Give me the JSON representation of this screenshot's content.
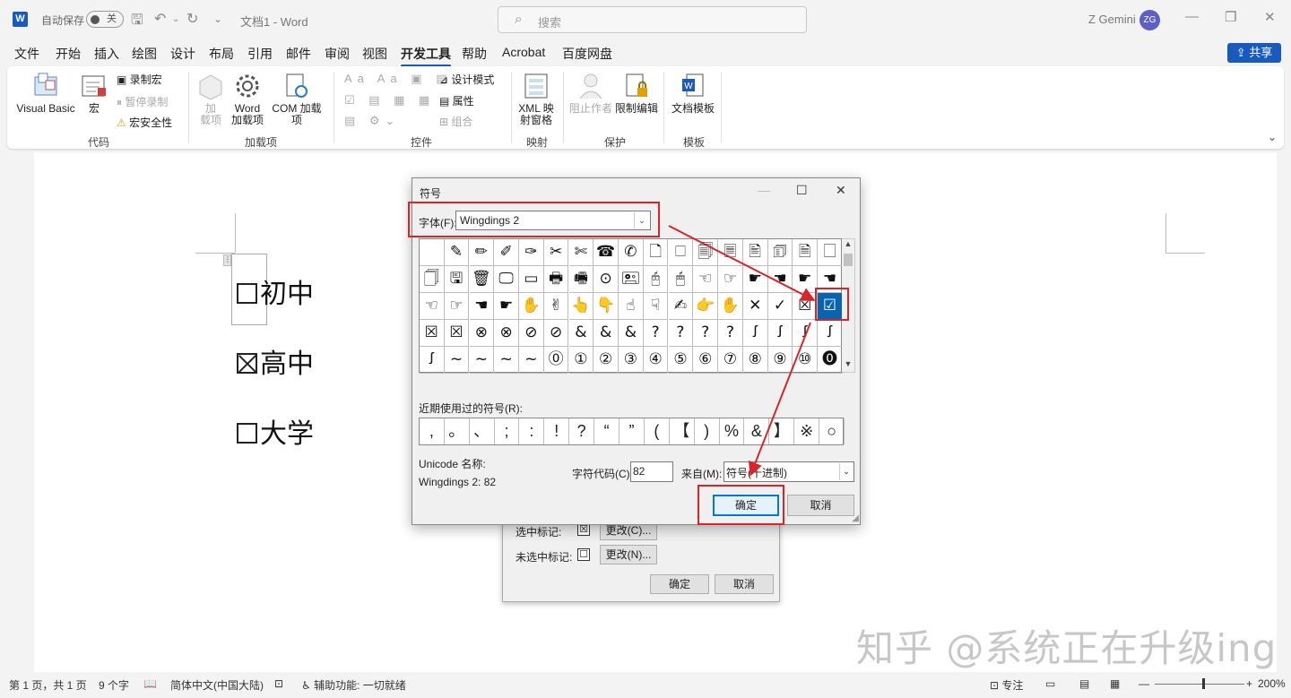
{
  "titlebar": {
    "app_icon": "W",
    "autosave_label": "自动保存",
    "autosave_state": "关",
    "doc_title": "文档1 - Word",
    "search_placeholder": "搜索",
    "user_name": "Z Gemini",
    "avatar_initials": "ZG"
  },
  "menu": [
    "文件",
    "开始",
    "插入",
    "绘图",
    "设计",
    "布局",
    "引用",
    "邮件",
    "审阅",
    "视图",
    "开发工具",
    "帮助",
    "Acrobat",
    "百度网盘"
  ],
  "share_label": "共享",
  "ribbon": {
    "visual_basic": "Visual Basic",
    "macros": "宏",
    "record_macro": "录制宏",
    "pause_record": "暂停录制",
    "macro_security": "宏安全性",
    "group_code": "代码",
    "addins": "加\n载项",
    "addins_a": "加",
    "addins_b": "载项",
    "word_addins_a": "Word",
    "word_addins_b": "加载项",
    "com_addins": "COM 加载项",
    "group_addins": "加载项",
    "design_mode": "设计模式",
    "properties": "属性",
    "group": "组合",
    "group_controls": "控件",
    "xml_a": "XML 映",
    "xml_b": "射窗格",
    "group_mapping": "映射",
    "block_authors": "阻止作者",
    "restrict_editing": "限制编辑",
    "group_protect": "保护",
    "doc_template": "文档模板",
    "group_templates": "模板"
  },
  "document": {
    "lines": [
      "初中",
      "高中",
      "大学"
    ]
  },
  "bg_dialog": {
    "checked_label": "选中标记:",
    "checked_symbol": "☒",
    "change_checked": "更改(C)...",
    "unchecked_label": "未选中标记:",
    "unchecked_symbol": "☐",
    "change_unchecked": "更改(N)...",
    "ok": "确定",
    "cancel": "取消"
  },
  "symbol_dialog": {
    "title": "符号",
    "font_label": "字体(F):",
    "font_value": "Wingdings 2",
    "grid_rows": [
      [
        "",
        "✎",
        "✏",
        "✐",
        "✑",
        "✂",
        "✄",
        "☎",
        "✆",
        "🗋",
        "🗆",
        "🗐",
        "🗏",
        "🖹",
        "🗊",
        "🗎",
        "🗌"
      ],
      [
        "🗍",
        "🖫",
        "🗑",
        "🖵",
        "▭",
        "🖶",
        "🖷",
        "⊙",
        "🖭",
        "🖰",
        "🖱",
        "☜",
        "☞",
        "☛",
        "☚",
        "☛",
        "☚"
      ],
      [
        "☜",
        "☞",
        "☚",
        "☛",
        "✋",
        "✌",
        "👆",
        "👇",
        "☝",
        "☟",
        "✍",
        "👉",
        "✋",
        "✕",
        "✓",
        "☒",
        "☑"
      ],
      [
        "☒",
        "☒",
        "⊗",
        "⊗",
        "⊘",
        "⊘",
        "&",
        "&",
        "&",
        "?",
        "?",
        "?",
        "?",
        "ꭍ",
        "ꭍ",
        "ꭍ",
        "ꭍ"
      ],
      [
        "ꭍ",
        "~",
        "~",
        "~",
        "~",
        "⓪",
        "①",
        "②",
        "③",
        "④",
        "⑤",
        "⑥",
        "⑦",
        "⑧",
        "⑨",
        "⑩",
        "⓿"
      ]
    ],
    "recent_label": "近期使用过的符号(R):",
    "recent": [
      ",",
      "。",
      "、",
      ";",
      ":",
      "!",
      "?",
      "“",
      "”",
      "(",
      "【",
      ")",
      "%",
      "&",
      "】",
      "※",
      "○"
    ],
    "unicode_label": "Unicode 名称:",
    "unicode_value": "Wingdings 2: 82",
    "code_label": "字符代码(C):",
    "code_value": "82",
    "from_label": "来自(M):",
    "from_value": "符号(十进制)",
    "ok": "确定",
    "cancel": "取消"
  },
  "statusbar": {
    "page": "第 1 页，共 1 页",
    "words": "9 个字",
    "language": "简体中文(中国大陆)",
    "accessibility": "辅助功能: 一切就绪",
    "focus": "专注",
    "zoom": "200%"
  },
  "watermark": "知乎 @系统正在升级ing",
  "colors": {
    "accent": "#185abd",
    "highlight": "#d9252a",
    "selection": "#0a64ad"
  }
}
